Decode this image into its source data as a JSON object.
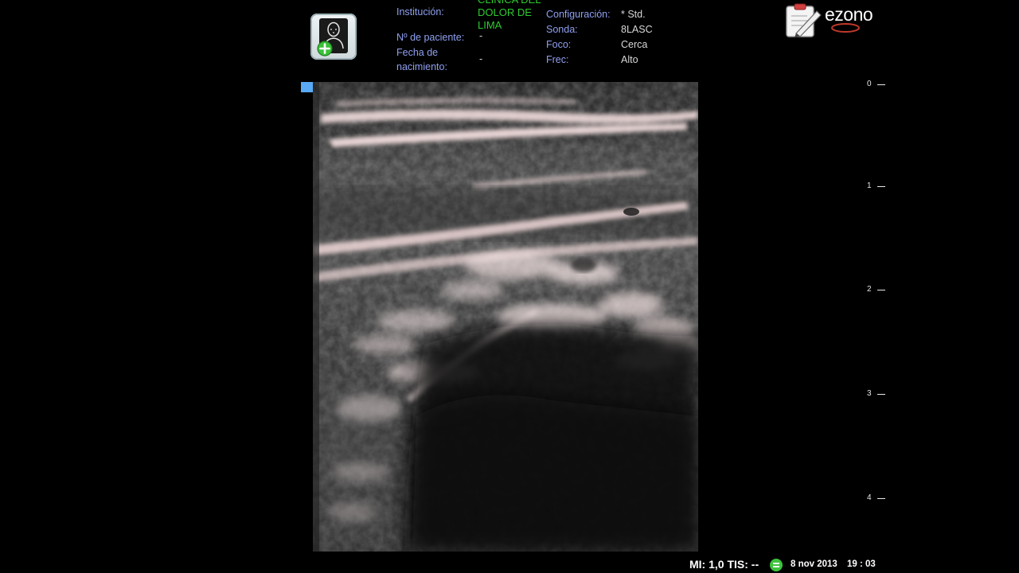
{
  "header": {
    "patient_button_icon": "new-patient-icon",
    "fields": {
      "institution_label": "Institución:",
      "institution_value": "CLÍNICA DEL DOLOR DE LIMA",
      "patient_no_label": "Nº de paciente:",
      "patient_no_value": "-",
      "birthdate_label_line1": "Fecha de",
      "birthdate_label_line2": "nacimiento:",
      "birthdate_value": "-",
      "config_label": "Configuración:",
      "config_value": "* Std.",
      "probe_label": "Sonda:",
      "probe_value": "8LASC",
      "focus_label": "Foco:",
      "focus_value": "Cerca",
      "freq_label": "Frec:",
      "freq_value": "Alto"
    },
    "logo_text": "ezono",
    "logo_icon": "clipboard-pen-icon"
  },
  "depth_scale": {
    "unit_marks": [
      "0",
      "1",
      "2",
      "3",
      "4"
    ]
  },
  "status_bar": {
    "mi_tis": "MI: 1,0 TIS: --",
    "date": "8 nov 2013",
    "time": "19 : 03",
    "network_icon": "network-status-icon"
  },
  "colors": {
    "label_blue": "#8fa0f0",
    "institution_green": "#2ecc2e",
    "marker_blue": "#5aa9f5",
    "status_green": "#3ec33e"
  }
}
